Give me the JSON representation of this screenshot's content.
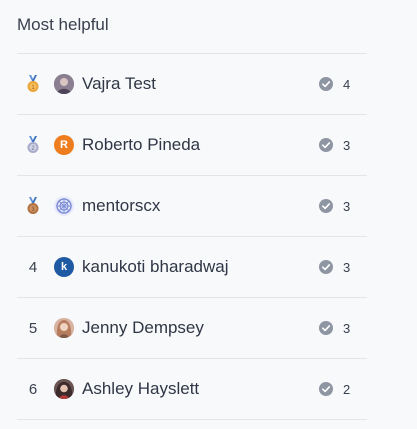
{
  "header": {
    "title": "Most helpful"
  },
  "colors": {
    "border": "#e2e5ea",
    "check": "#8f96a3",
    "gold": "#e9a33a",
    "silver": "#a7a9c9",
    "bronze": "#b06f3f"
  },
  "leaders": [
    {
      "rank": "",
      "medal": "gold-medal-icon",
      "name": "Vajra Test",
      "count": "4",
      "avatar": "photo",
      "avatar_color": "#7b6f83"
    },
    {
      "rank": "",
      "medal": "silver-medal-icon",
      "name": "Roberto Pineda",
      "count": "3",
      "avatar": "R",
      "avatar_color": "#ee7d1f"
    },
    {
      "rank": "",
      "medal": "bronze-medal-icon",
      "name": "mentorscx",
      "count": "3",
      "avatar": "pattern",
      "avatar_color": "#7f8fd6"
    },
    {
      "rank": "4",
      "medal": "",
      "name": "kanukoti bharadwaj",
      "count": "3",
      "avatar": "k",
      "avatar_color": "#1e5aa3"
    },
    {
      "rank": "5",
      "medal": "",
      "name": "Jenny Dempsey",
      "count": "3",
      "avatar": "photo",
      "avatar_color": "#c9967d"
    },
    {
      "rank": "6",
      "medal": "",
      "name": "Ashley Hayslett",
      "count": "2",
      "avatar": "photo",
      "avatar_color": "#5c4a48"
    }
  ]
}
